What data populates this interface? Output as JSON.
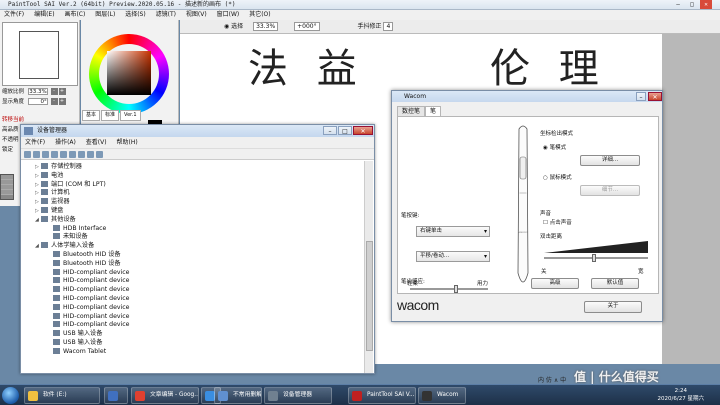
{
  "sai": {
    "title": "PaintTool SAI Ver.2 (64bit) Preview.2020.05.16 - 描述新的画布 (*)",
    "menu": [
      "文件(F)",
      "编辑(E)",
      "画布(C)",
      "图层(L)",
      "选择(S)",
      "滤镜(T)",
      "视图(V)",
      "窗口(W)",
      "其它(O)"
    ],
    "left_rows": [
      {
        "label": "缩放比例",
        "value": "33.3%"
      },
      {
        "label": "显示角度",
        "value": "0°"
      }
    ],
    "panel_rows": [
      "转移当前",
      "高品质",
      "不透明",
      "锁定"
    ],
    "color_tabs": [
      "基本",
      "标准",
      "Ver.1"
    ],
    "toolbar": {
      "select_label": "选择",
      "zoom": "33.3%",
      "angle": "+000°",
      "stabilizer_label": "手抖修正",
      "stabilizer_value": "4"
    },
    "canvas_text": {
      "left": "法 益",
      "right": "伦 理"
    }
  },
  "device_manager": {
    "title": "设备管理器",
    "menu": [
      "文件(F)",
      "操作(A)",
      "查看(V)",
      "帮助(H)"
    ],
    "items": [
      {
        "text": "存储控制器",
        "level": 1,
        "arrow": "▷"
      },
      {
        "text": "电池",
        "level": 1,
        "arrow": "▷"
      },
      {
        "text": "端口 (COM 和 LPT)",
        "level": 1,
        "arrow": "▷"
      },
      {
        "text": "计算机",
        "level": 1,
        "arrow": "▷"
      },
      {
        "text": "监视器",
        "level": 1,
        "arrow": "▷"
      },
      {
        "text": "键盘",
        "level": 1,
        "arrow": "▷"
      },
      {
        "text": "其他设备",
        "level": 1,
        "arrow": "◢"
      },
      {
        "text": "HDB Interface",
        "level": 2,
        "arrow": ""
      },
      {
        "text": "未知设备",
        "level": 2,
        "arrow": ""
      },
      {
        "text": "人体学输入设备",
        "level": 1,
        "arrow": "◢"
      },
      {
        "text": "Bluetooth HID 设备",
        "level": 2,
        "arrow": ""
      },
      {
        "text": "Bluetooth HID 设备",
        "level": 2,
        "arrow": ""
      },
      {
        "text": "HID-compliant device",
        "level": 2,
        "arrow": ""
      },
      {
        "text": "HID-compliant device",
        "level": 2,
        "arrow": ""
      },
      {
        "text": "HID-compliant device",
        "level": 2,
        "arrow": ""
      },
      {
        "text": "HID-compliant device",
        "level": 2,
        "arrow": ""
      },
      {
        "text": "HID-compliant device",
        "level": 2,
        "arrow": ""
      },
      {
        "text": "HID-compliant device",
        "level": 2,
        "arrow": ""
      },
      {
        "text": "HID-compliant device",
        "level": 2,
        "arrow": ""
      },
      {
        "text": "USB 输入设备",
        "level": 2,
        "arrow": ""
      },
      {
        "text": "USB 输入设备",
        "level": 2,
        "arrow": ""
      },
      {
        "text": "Wacom Tablet",
        "level": 2,
        "arrow": ""
      }
    ]
  },
  "wacom": {
    "title": "Wacom",
    "tabs": [
      "数控笔",
      "笔"
    ],
    "mode_label": "坐标检出模式",
    "pen_mode": "笔模式",
    "mouse_mode": "鼠标模式",
    "detail_button": "详细...",
    "detail_button2": "细节...",
    "pen_button_label": "笔按键:",
    "dropdown1": "右键单击",
    "dropdown2": "平移/卷动...",
    "pressure_label": "笔尖感应:",
    "light": "轻柔",
    "firm": "用力",
    "sound_label": "声音",
    "sound_check": "点击声音",
    "double_click_label": "双击距离",
    "off": "关",
    "large": "宽",
    "advanced_button": "高级",
    "default_button": "默认值",
    "logo": "wacom",
    "about_button": "关于"
  },
  "taskbar": {
    "items": [
      {
        "label": "软件 (E:)",
        "color": "#f0c040"
      },
      {
        "label": "",
        "color": "#4070c0"
      },
      {
        "label": "文章编辑 - Goog...",
        "color": "#e04030"
      },
      {
        "label": "Google - Goog...",
        "color": "#3a8ee0"
      },
      {
        "label": "不常用删解",
        "color": "#6090d0"
      },
      {
        "label": "设备管理器",
        "color": "#708090"
      },
      {
        "label": "PaintTool SAI V...",
        "color": "#c02020"
      },
      {
        "label": "Wacom",
        "color": "#333333"
      }
    ],
    "time": "2:24",
    "date": "2020/6/27 星期六"
  },
  "tray_text": "内 仿 ∧ 中",
  "watermark": "值 | 什么值得买"
}
